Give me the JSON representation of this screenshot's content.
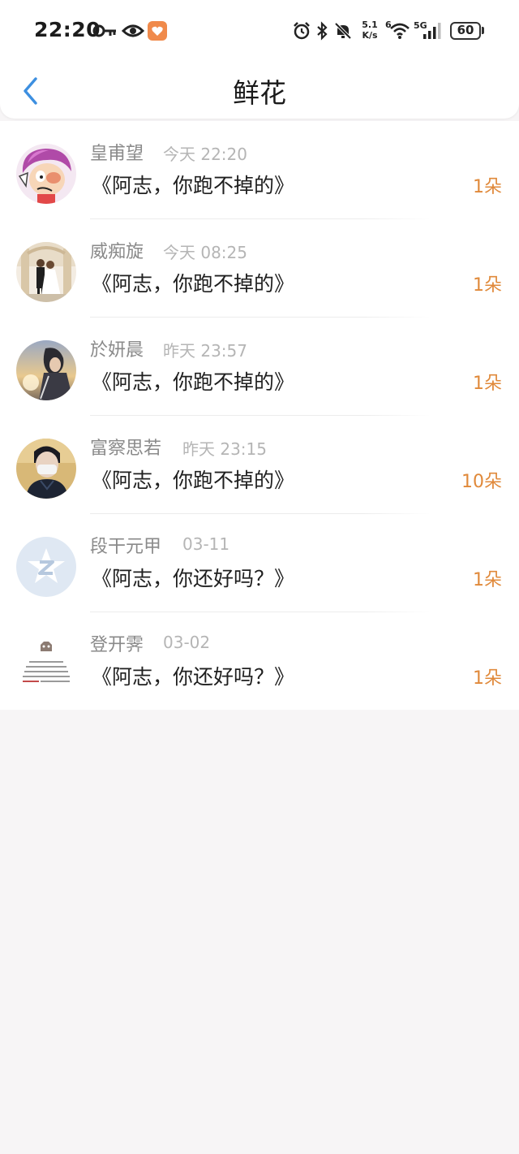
{
  "status_bar": {
    "time": "22:20",
    "net_speed_value": "5.1",
    "net_speed_unit": "K/s",
    "battery": "60",
    "signal_label": "5G",
    "wifi_sim": "6"
  },
  "header": {
    "title": "鲜花"
  },
  "colors": {
    "accent_count": "#e0893a",
    "back_arrow": "#3d8fe0",
    "background": "#f7f5f6"
  },
  "records": [
    {
      "name": "皇甫望",
      "time": "今天 22:20",
      "gift": "《阿志，你跑不掉的》",
      "count": "1朵"
    },
    {
      "name": "威痴旋",
      "time": "今天 08:25",
      "gift": "《阿志，你跑不掉的》",
      "count": "1朵"
    },
    {
      "name": "於妍晨",
      "time": "昨天 23:57",
      "gift": "《阿志，你跑不掉的》",
      "count": "1朵"
    },
    {
      "name": "富察思若",
      "time": "昨天 23:15",
      "gift": "《阿志，你跑不掉的》",
      "count": "10朵"
    },
    {
      "name": "段干元甲",
      "time": "03-11",
      "gift": "《阿志，你还好吗？》",
      "count": "1朵"
    },
    {
      "name": "登开霁",
      "time": "03-02",
      "gift": "《阿志，你还好吗？》",
      "count": "1朵"
    }
  ]
}
